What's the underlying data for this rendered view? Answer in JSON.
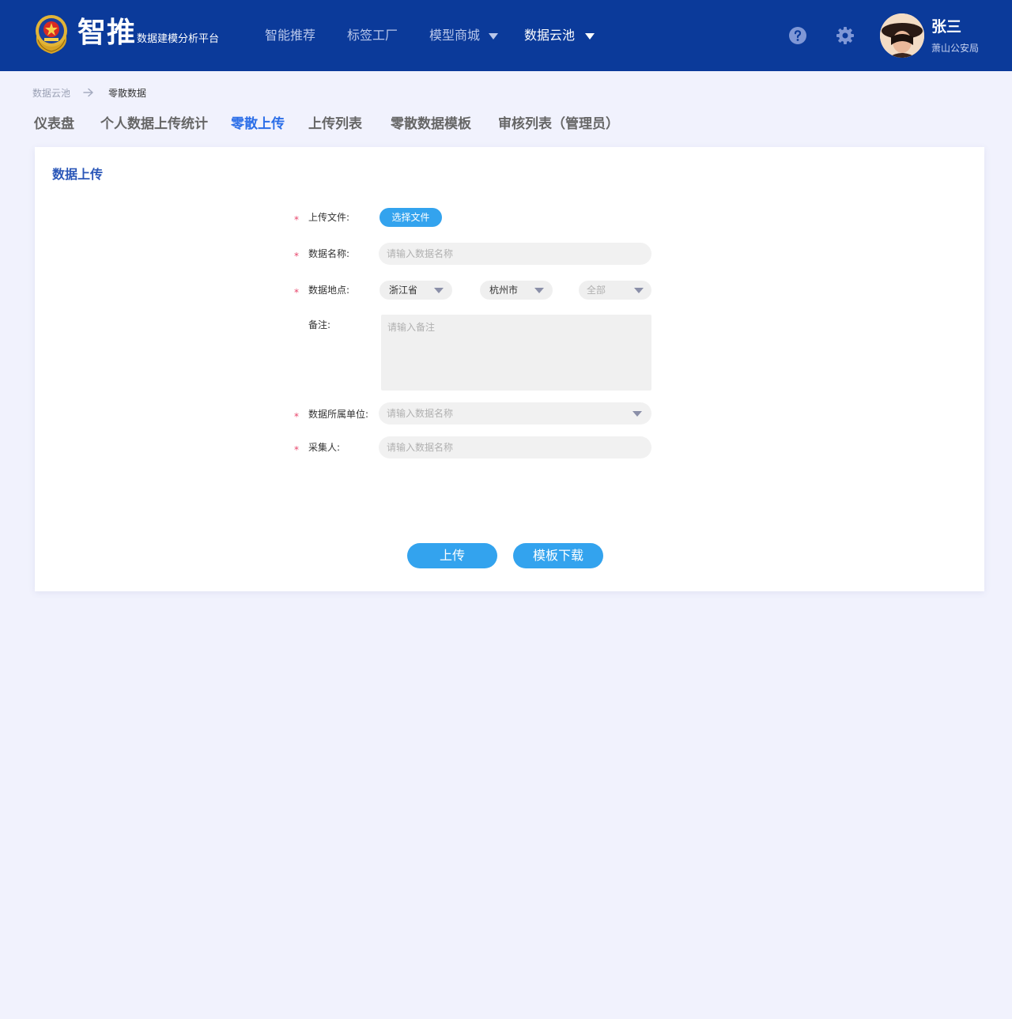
{
  "header": {
    "brand_title": "智推",
    "brand_subtitle": "数据建模分析平台",
    "nav": [
      {
        "label": "智能推荐",
        "active": false,
        "has_dropdown": false
      },
      {
        "label": "标签工厂",
        "active": false,
        "has_dropdown": false
      },
      {
        "label": "模型商城",
        "active": false,
        "has_dropdown": true
      },
      {
        "label": "数据云池",
        "active": true,
        "has_dropdown": true
      }
    ],
    "icons": [
      "help-icon",
      "settings-icon"
    ],
    "user": {
      "name": "张三",
      "org": "萧山公安局"
    }
  },
  "breadcrumb": {
    "parent": "数据云池",
    "current": "零散数据"
  },
  "tabs": [
    {
      "label": "仪表盘",
      "active": false
    },
    {
      "label": "个人数据上传统计",
      "active": false
    },
    {
      "label": "零散上传",
      "active": true
    },
    {
      "label": "上传列表",
      "active": false
    },
    {
      "label": "零散数据模板",
      "active": false
    },
    {
      "label": "审核列表（管理员）",
      "active": false
    }
  ],
  "form": {
    "title": "数据上传",
    "required_mark": "*",
    "file": {
      "label": "上传文件:",
      "button": "选择文件"
    },
    "name": {
      "label": "数据名称:",
      "placeholder": "请输入数据名称"
    },
    "location": {
      "label": "数据地点:",
      "province": "浙江省",
      "city": "杭州市",
      "district": "全部"
    },
    "remark": {
      "label": "备注:",
      "placeholder": "请输入备注"
    },
    "unit": {
      "label": "数据所属单位:",
      "placeholder": "请输入数据名称"
    },
    "collector": {
      "label": "采集人:",
      "placeholder": "请输入数据名称"
    },
    "upload_button": "上传",
    "template_button": "模板下载"
  },
  "colors": {
    "header_bg": "#0b3a9a",
    "page_bg": "#f1f2fd",
    "accent": "#33a3ee",
    "active_tab": "#2b6ee8",
    "required": "#e8456b"
  }
}
